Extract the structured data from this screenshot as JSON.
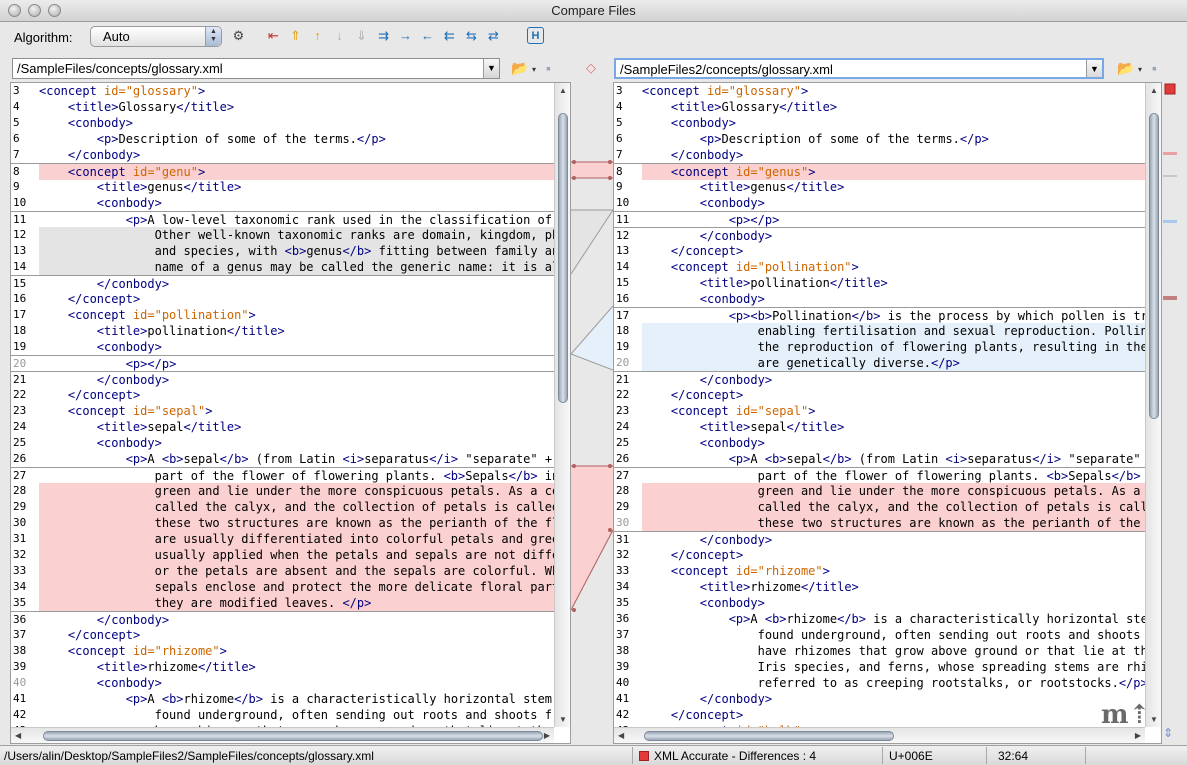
{
  "window": {
    "title": "Compare Files"
  },
  "toolbar": {
    "algorithm_label": "Algorithm:",
    "algorithm_value": "Auto"
  },
  "left": {
    "path": "/SampleFiles/concepts/glossary.xml",
    "lines": [
      {
        "n": "3",
        "t": "<concept id=\"glossary\">"
      },
      {
        "n": "4",
        "t": "    <title>Glossary</title>"
      },
      {
        "n": "5",
        "t": "    <conbody>"
      },
      {
        "n": "6",
        "t": "        <p>Description of some of the terms.</p>"
      },
      {
        "n": "7",
        "t": "    </conbody>"
      },
      {
        "n": "8",
        "t": "    <concept id=\"genu\">"
      },
      {
        "n": "9",
        "t": "        <title>genus</title>"
      },
      {
        "n": "10",
        "t": "        <conbody>"
      },
      {
        "n": "11",
        "t": "            <p>A low-level taxonomic rank used in the classification of living"
      },
      {
        "n": "12",
        "t": "                Other well-known taxonomic ranks are domain, kingdom, phylum"
      },
      {
        "n": "13",
        "t": "                and species, with <b>genus</b> fitting between family and spe"
      },
      {
        "n": "14",
        "t": "                name of a genus may be called the generic name: it is always"
      },
      {
        "n": "15",
        "t": "        </conbody>"
      },
      {
        "n": "16",
        "t": "    </concept>"
      },
      {
        "n": "17",
        "t": "    <concept id=\"pollination\">"
      },
      {
        "n": "18",
        "t": "        <title>pollination</title>"
      },
      {
        "n": "19",
        "t": "        <conbody>"
      },
      {
        "n": "20",
        "t": "            <p></p>"
      },
      {
        "n": "21",
        "t": "        </conbody>"
      },
      {
        "n": "22",
        "t": "    </concept>"
      },
      {
        "n": "23",
        "t": "    <concept id=\"sepal\">"
      },
      {
        "n": "24",
        "t": "        <title>sepal</title>"
      },
      {
        "n": "25",
        "t": "        <conbody>"
      },
      {
        "n": "26",
        "t": "            <p>A <b>sepal</b> (from Latin <i>separatus</i> \"separate\" + <i>pe"
      },
      {
        "n": "27",
        "t": "                part of the flower of flowering plants. <b>Sepals</b> in a f"
      },
      {
        "n": "28",
        "t": "                green and lie under the more conspicuous petals. As a collect"
      },
      {
        "n": "29",
        "t": "                called the calyx, and the collection of petals is called the"
      },
      {
        "n": "30",
        "t": "                these two structures are known as the perianth of the flower"
      },
      {
        "n": "31",
        "t": "                are usually differentiated into colorful petals and green sep"
      },
      {
        "n": "32",
        "t": "                usually applied when the petals and sepals are not different"
      },
      {
        "n": "33",
        "t": "                or the petals are absent and the sepals are colorful. When th"
      },
      {
        "n": "34",
        "t": "                sepals enclose and protect the more delicate floral parts wit"
      },
      {
        "n": "35",
        "t": "                they are modified leaves. </p>"
      },
      {
        "n": "36",
        "t": "        </conbody>"
      },
      {
        "n": "37",
        "t": "    </concept>"
      },
      {
        "n": "38",
        "t": "    <concept id=\"rhizome\">"
      },
      {
        "n": "39",
        "t": "        <title>rhizome</title>"
      },
      {
        "n": "40",
        "t": "        <conbody>"
      },
      {
        "n": "41",
        "t": "            <p>A <b>rhizome</b> is a characteristically horizontal stem of a"
      },
      {
        "n": "42",
        "t": "                found underground, often sending out roots and shoots from it"
      },
      {
        "n": "43",
        "t": "                have rhizomes that grow above ground or that lie at the soil"
      }
    ]
  },
  "right": {
    "path": "/SampleFiles2/concepts/glossary.xml",
    "lines": [
      {
        "n": "3",
        "t": "<concept id=\"glossary\">"
      },
      {
        "n": "4",
        "t": "    <title>Glossary</title>"
      },
      {
        "n": "5",
        "t": "    <conbody>"
      },
      {
        "n": "6",
        "t": "        <p>Description of some of the terms.</p>"
      },
      {
        "n": "7",
        "t": "    </conbody>"
      },
      {
        "n": "8",
        "t": "    <concept id=\"genus\">"
      },
      {
        "n": "9",
        "t": "        <title>genus</title>"
      },
      {
        "n": "10",
        "t": "        <conbody>"
      },
      {
        "n": "11",
        "t": "            <p></p>"
      },
      {
        "n": "12",
        "t": "        </conbody>"
      },
      {
        "n": "13",
        "t": "    </concept>"
      },
      {
        "n": "14",
        "t": "    <concept id=\"pollination\">"
      },
      {
        "n": "15",
        "t": "        <title>pollination</title>"
      },
      {
        "n": "16",
        "t": "        <conbody>"
      },
      {
        "n": "17",
        "t": "            <p><b>Pollination</b> is the process by which pollen is transfe"
      },
      {
        "n": "18",
        "t": "                enabling fertilisation and sexual reproduction. Pollinatio"
      },
      {
        "n": "19",
        "t": "                the reproduction of flowering plants, resulting in the prod"
      },
      {
        "n": "20",
        "t": "                are genetically diverse.</p>"
      },
      {
        "n": "21",
        "t": "        </conbody>"
      },
      {
        "n": "22",
        "t": "    </concept>"
      },
      {
        "n": "23",
        "t": "    <concept id=\"sepal\">"
      },
      {
        "n": "24",
        "t": "        <title>sepal</title>"
      },
      {
        "n": "25",
        "t": "        <conbody>"
      },
      {
        "n": "26",
        "t": "            <p>A <b>sepal</b> (from Latin <i>separatus</i> \"separate\" + <i>pe"
      },
      {
        "n": "27",
        "t": "                part of the flower of flowering plants. <b>Sepals</b> in a"
      },
      {
        "n": "28",
        "t": "                green and lie under the more conspicuous petals. As a colle"
      },
      {
        "n": "29",
        "t": "                called the calyx, and the collection of petals is called th"
      },
      {
        "n": "30",
        "t": "                these two structures are known as the perianth of the flowe"
      },
      {
        "n": "31",
        "t": "        </conbody>"
      },
      {
        "n": "32",
        "t": "    </concept>"
      },
      {
        "n": "33",
        "t": "    <concept id=\"rhizome\">"
      },
      {
        "n": "34",
        "t": "        <title>rhizome</title>"
      },
      {
        "n": "35",
        "t": "        <conbody>"
      },
      {
        "n": "36",
        "t": "            <p>A <b>rhizome</b> is a characteristically horizontal stem of"
      },
      {
        "n": "37",
        "t": "                found underground, often sending out roots and shoots from"
      },
      {
        "n": "38",
        "t": "                have rhizomes that grow above ground or that lie at the soi"
      },
      {
        "n": "39",
        "t": "                Iris species, and ferns, whose spreading stems are rhizomes"
      },
      {
        "n": "40",
        "t": "                referred to as creeping rootstalks, or rootstocks.</p>"
      },
      {
        "n": "41",
        "t": "        </conbody>"
      },
      {
        "n": "42",
        "t": "    </concept>"
      },
      {
        "n": "43",
        "t": "    <concept id=\"bulb\">"
      }
    ]
  },
  "status": {
    "path": "/Users/alin/Desktop/SampleFiles2/SampleFiles/concepts/glossary.xml",
    "diff_mode": "XML Accurate - Differences : 4",
    "char_code": "U+006E",
    "cursor": "32:64"
  },
  "colors": {
    "diff_red": "#fbd0d0",
    "diff_grey": "#e4e4e4",
    "diff_blue": "#e6f0fa",
    "tag": "#000080",
    "attr": "#cc6600"
  }
}
